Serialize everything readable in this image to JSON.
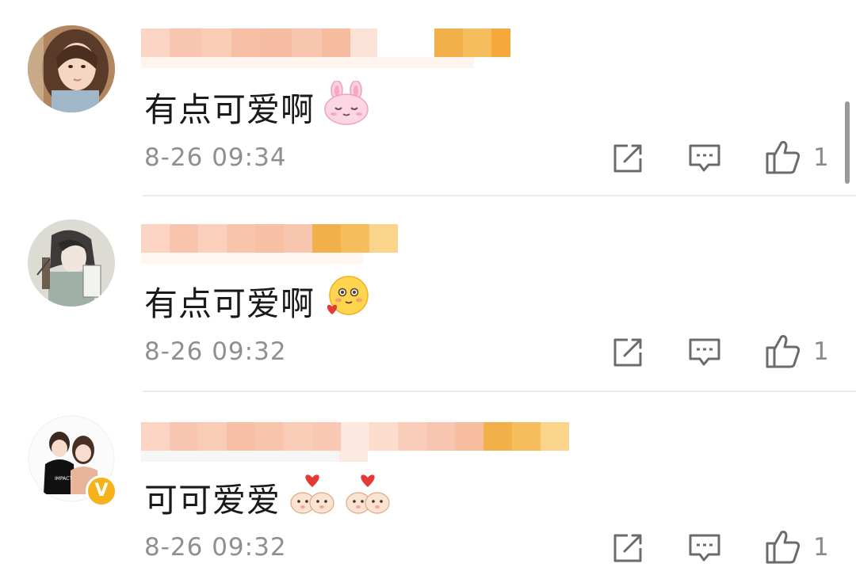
{
  "comments": [
    {
      "text": "有点可爱啊",
      "emoji": "rabbit-face-emoji",
      "time": "8-26 09:34",
      "like_count": "1",
      "avatar": "girl-portrait-avatar"
    },
    {
      "text": "有点可爱啊",
      "emoji": "smiling-face-with-heart-emoji",
      "time": "8-26 09:32",
      "like_count": "1",
      "avatar": "anime-drawing-avatar"
    },
    {
      "text": "可可爱爱",
      "emoji": "cat-couple-heart-emoji",
      "time": "8-26 09:32",
      "like_count": "1",
      "avatar": "cartoon-couple-avatar",
      "verified_badge": "V"
    }
  ],
  "icons": {
    "repost": "share-icon",
    "reply": "comment-icon",
    "like": "thumbs-up-icon"
  },
  "colors": {
    "username_blur_pink": "#f8c0a8",
    "username_blur_orange": "#f5b04a",
    "text": "#1a1a1a",
    "meta": "#8f8f8f",
    "verified": "#f6b21b"
  }
}
